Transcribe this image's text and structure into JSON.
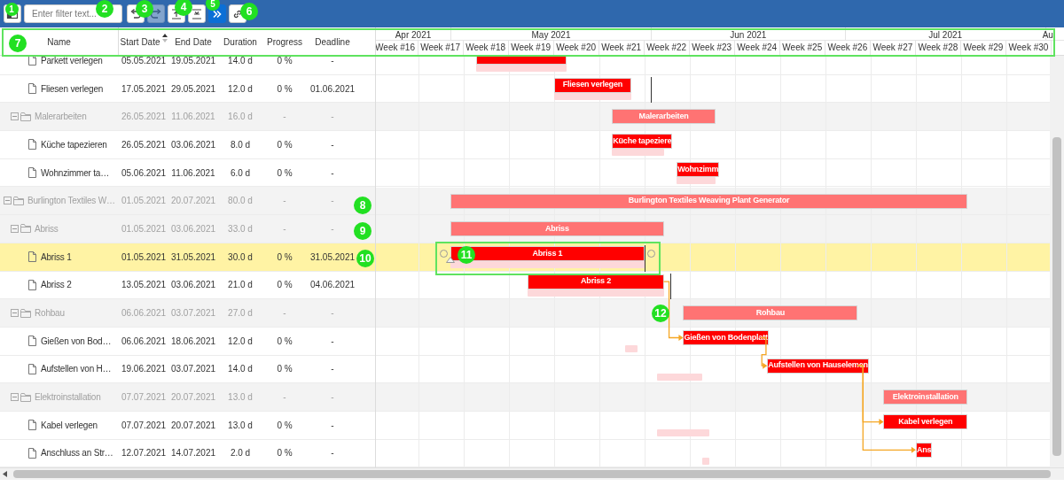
{
  "toolbar": {
    "items": [
      {
        "kind": "button",
        "disabled": false,
        "on": false
      },
      {
        "kind": "filter",
        "placeholder": "Enter filter text..."
      },
      {
        "kind": "button",
        "disabled": false,
        "on": false
      },
      {
        "kind": "button",
        "disabled": true,
        "on": false
      },
      {
        "kind": "button",
        "disabled": false,
        "on": false
      },
      {
        "kind": "button",
        "disabled": false,
        "on": false
      },
      {
        "kind": "button",
        "disabled": false,
        "on": true
      },
      {
        "kind": "button",
        "disabled": false,
        "on": false
      }
    ]
  },
  "columns": [
    {
      "label": "Name",
      "sorted": false
    },
    {
      "label": "Start Date",
      "sorted": true
    },
    {
      "label": "End Date",
      "sorted": false
    },
    {
      "label": "Duration",
      "sorted": false
    },
    {
      "label": "Progress",
      "sorted": false
    },
    {
      "label": "Deadline",
      "sorted": false
    }
  ],
  "timeline": {
    "months": [
      "Apr 2021",
      "May 2021",
      "Jun 2021",
      "Jul 2021",
      "Au"
    ],
    "weeks": [
      "Week #16",
      "Week #17",
      "Week #18",
      "Week #19",
      "Week #20",
      "Week #21",
      "Week #22",
      "Week #23",
      "Week #24",
      "Week #25",
      "Week #26",
      "Week #27",
      "Week #28",
      "Week #29",
      "Week #30"
    ]
  },
  "tasks": [
    {
      "children": [
        {
          "children": [
            {
              "kind": "task",
              "name": "Parkett verlegen",
              "start": "05.05.2021",
              "end": "19.05.2021",
              "duration": "14.0 d",
              "progress": "0 %",
              "deadline": "-",
              "selected": false
            },
            {
              "kind": "task",
              "name": "Fliesen verlegen",
              "start": "17.05.2021",
              "end": "29.05.2021",
              "duration": "12.0 d",
              "progress": "0 %",
              "deadline": "01.06.2021",
              "bar_label": "Fliesen verlegen",
              "selected": false
            }
          ]
        },
        {
          "kind": "summary",
          "name": "Malerarbeiten",
          "expanded": true,
          "start": "26.05.2021",
          "end": "11.06.2021",
          "duration": "16.0 d",
          "progress": "-",
          "deadline": "-",
          "bar_label": "Malerarbeiten",
          "selected": false,
          "children": [
            {
              "kind": "task",
              "name": "Küche tapezieren",
              "start": "26.05.2021",
              "end": "03.06.2021",
              "duration": "8.0 d",
              "progress": "0 %",
              "deadline": "-",
              "bar_label": "Küche tapeziere",
              "selected": false
            },
            {
              "kind": "task",
              "name": "Wohnzimmer ta…",
              "start": "05.06.2021",
              "end": "11.06.2021",
              "duration": "6.0 d",
              "progress": "0 %",
              "deadline": "-",
              "bar_label": "Wohnzimm",
              "selected": false
            }
          ]
        }
      ]
    },
    {
      "kind": "summary",
      "name": "Burlington Textiles W…",
      "expanded": true,
      "start": "01.05.2021",
      "end": "20.07.2021",
      "duration": "80.0 d",
      "progress": "-",
      "deadline": "-",
      "bar_label": "Burlington Textiles Weaving Plant Generator",
      "selected": false,
      "children": [
        {
          "kind": "summary",
          "name": "Abriss",
          "expanded": true,
          "start": "01.05.2021",
          "end": "03.06.2021",
          "duration": "33.0 d",
          "progress": "-",
          "deadline": "-",
          "bar_label": "Abriss",
          "selected": false,
          "children": [
            {
              "kind": "task",
              "name": "Abriss 1",
              "start": "01.05.2021",
              "end": "31.05.2021",
              "duration": "30.0 d",
              "progress": "0 %",
              "deadline": "31.05.2021",
              "bar_label": "Abriss 1",
              "selected": true
            },
            {
              "kind": "task",
              "name": "Abriss 2",
              "start": "13.05.2021",
              "end": "03.06.2021",
              "duration": "21.0 d",
              "progress": "0 %",
              "deadline": "04.06.2021",
              "bar_label": "Abriss 2",
              "selected": false,
              "link_out": true
            }
          ]
        },
        {
          "kind": "summary",
          "name": "Rohbau",
          "expanded": true,
          "start": "06.06.2021",
          "end": "03.07.2021",
          "duration": "27.0 d",
          "progress": "-",
          "deadline": "-",
          "bar_label": "Rohbau",
          "selected": false,
          "children": [
            {
              "kind": "task",
              "name": "Gießen von Bod…",
              "start": "06.06.2021",
              "end": "18.06.2021",
              "duration": "12.0 d",
              "progress": "0 %",
              "deadline": "-",
              "bar_label": "Gießen von Bodenplatt",
              "selected": false,
              "link_in": true,
              "link_out": true
            },
            {
              "kind": "task",
              "name": "Aufstellen von H…",
              "start": "19.06.2021",
              "end": "03.07.2021",
              "duration": "14.0 d",
              "progress": "0 %",
              "deadline": "-",
              "bar_label": "Aufstellen von Hauselemen",
              "selected": false,
              "link_in": true,
              "link_out": true
            }
          ]
        },
        {
          "kind": "summary",
          "name": "Elektroinstallation",
          "expanded": true,
          "start": "07.07.2021",
          "end": "20.07.2021",
          "duration": "13.0 d",
          "progress": "-",
          "deadline": "-",
          "bar_label": "Elektroinstallation",
          "selected": false,
          "children": [
            {
              "kind": "task",
              "name": "Kabel verlegen",
              "start": "07.07.2021",
              "end": "20.07.2021",
              "duration": "13.0 d",
              "progress": "0 %",
              "deadline": "-",
              "bar_label": "Kabel verlegen",
              "selected": false,
              "link_in": true
            },
            {
              "kind": "task",
              "name": "Anschluss an Str…",
              "start": "12.07.2021",
              "end": "14.07.2021",
              "duration": "2.0 d",
              "progress": "0 %",
              "deadline": "-",
              "bar_label": "Ans",
              "selected": false,
              "link_in": true
            }
          ]
        }
      ]
    }
  ],
  "callouts": [
    "1",
    "2",
    "3",
    "4",
    "5",
    "6",
    "7",
    "8",
    "9",
    "10",
    "11",
    "12"
  ]
}
